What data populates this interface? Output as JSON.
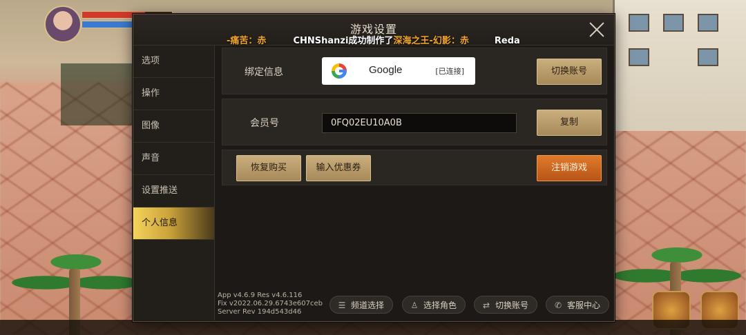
{
  "dialog": {
    "title": "游戏设置",
    "marquee": {
      "part1": "-痛苦：赤",
      "part2": "CHNShanzi成功制作了",
      "part3": "深海之王-幻影：赤",
      "part4": "Reda"
    }
  },
  "sidebar": {
    "items": [
      {
        "label": "选项"
      },
      {
        "label": "操作"
      },
      {
        "label": "图像"
      },
      {
        "label": "声音"
      },
      {
        "label": "设置推送"
      },
      {
        "label": "个人信息"
      }
    ],
    "active_index": 5
  },
  "binding": {
    "label": "绑定信息",
    "provider": "Google",
    "status": "[已连接]",
    "switch_button": "切换账号"
  },
  "member": {
    "label": "会员号",
    "value": "0FQ02EU10A0B",
    "copy_button": "复制"
  },
  "actions": {
    "restore_purchase": "恢复购买",
    "enter_coupon": "输入优惠券",
    "logout_game": "注销游戏"
  },
  "version": {
    "app": "App v4.6.9 Res v4.6.116",
    "fix": "Fix v2022.06.29.6743e607ceb",
    "server": "Server Rev 194d543d46"
  },
  "footer": {
    "channel_select": "频道选择",
    "character_select": "选择角色",
    "switch_account": "切换账号",
    "support_center": "客服中心"
  },
  "colors": {
    "gold_button": "#b89a6a",
    "orange_button": "#d06a22",
    "active_tab": "#f4d35a"
  }
}
